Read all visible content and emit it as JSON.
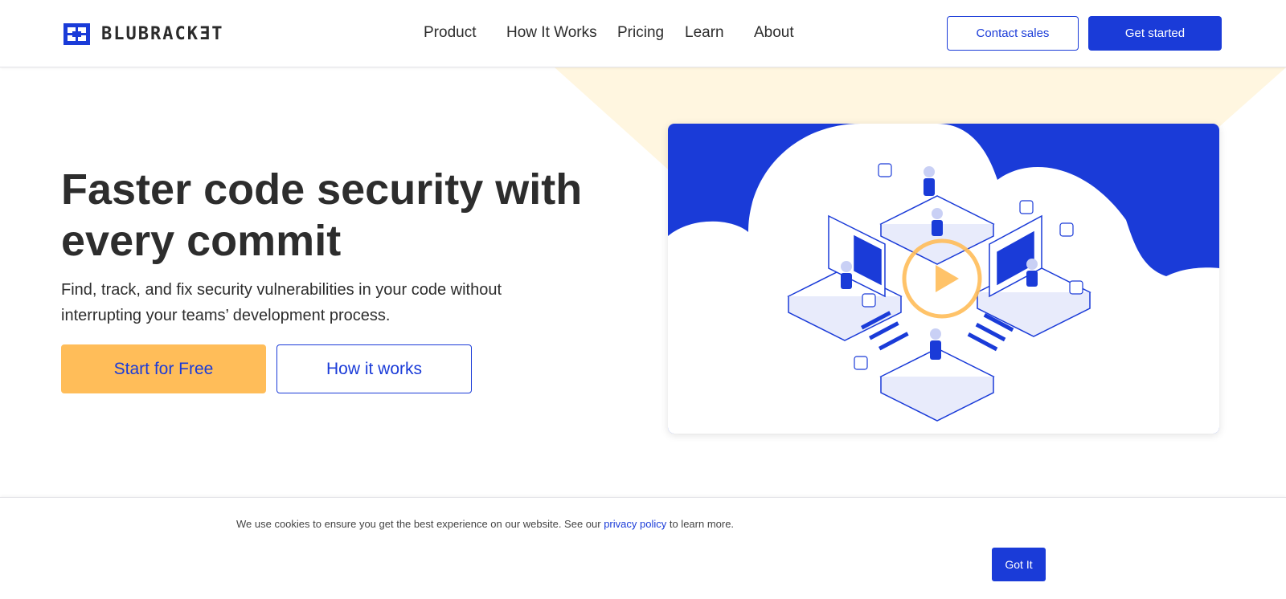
{
  "brand": {
    "name": "BLUBRACKƎT",
    "primary_color": "#1a3bd8",
    "accent_color": "#ffbd59"
  },
  "nav": {
    "items": [
      {
        "label": "Product"
      },
      {
        "label": "How It Works"
      },
      {
        "label": "Pricing"
      },
      {
        "label": "Learn"
      },
      {
        "label": "About"
      }
    ],
    "contact_label": "Contact sales",
    "started_label": "Get started"
  },
  "hero": {
    "title": "Faster code security with every commit",
    "subtitle": "Find, track, and fix security vulnerabilities in your code without interrupting your teams’ development process.",
    "primary_cta": "Start for Free",
    "secondary_cta": "How it works",
    "video": {
      "icon": "play-icon"
    }
  },
  "cookie": {
    "text_before": "We use cookies to ensure you get the best experience on our website. See our ",
    "link_text": "privacy policy",
    "text_after": " to learn more.",
    "button_label": "Got It"
  }
}
